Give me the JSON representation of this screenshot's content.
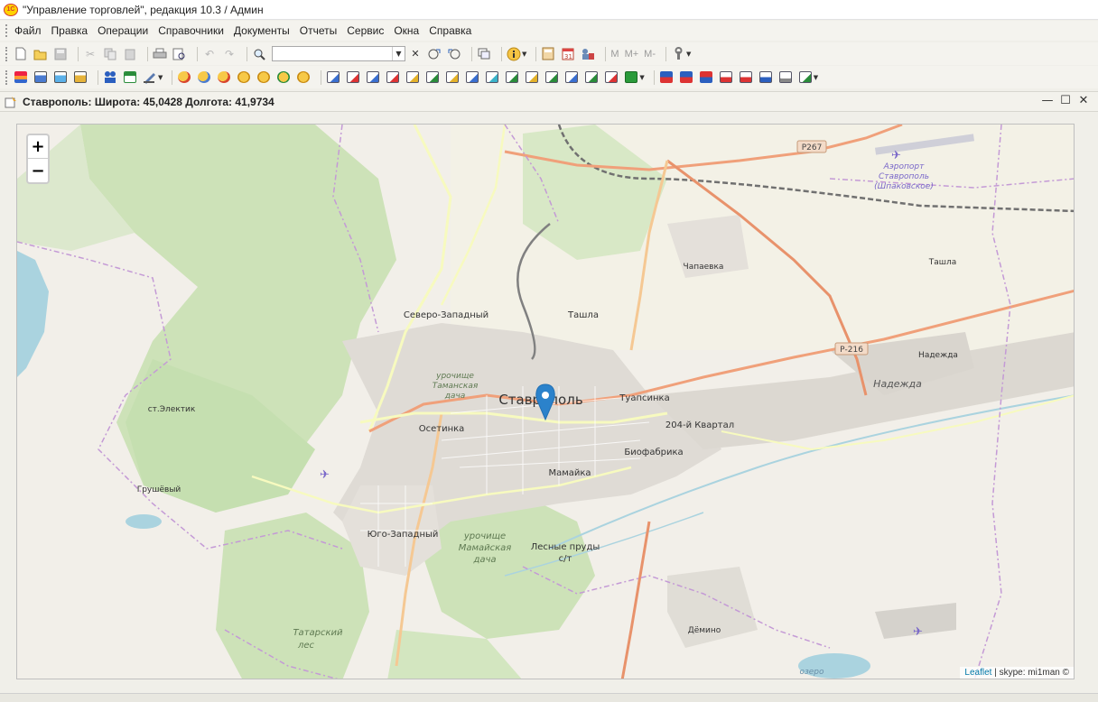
{
  "window": {
    "title": "\"Управление торговлей\", редакция 10.3 / Админ",
    "logo_text": "1С"
  },
  "menu": [
    "Файл",
    "Правка",
    "Операции",
    "Справочники",
    "Документы",
    "Отчеты",
    "Сервис",
    "Окна",
    "Справка"
  ],
  "toolbar": {
    "search_value": "",
    "memory_m": "M",
    "memory_mplus": "M+",
    "memory_mminus": "M-"
  },
  "form": {
    "title": "Ставрополь:  Широта: 45,0428 Долгота: 41,9734"
  },
  "map": {
    "labels": {
      "stavropol": "Ставрополь",
      "severo_zapadny": "Северо-Западный",
      "tashla_city": "Ташла",
      "tashla_village": "Ташла",
      "chapaevka": "Чапаевка",
      "airport_line1": "Аэропорт",
      "airport_line2": "Ставрополь",
      "airport_line3": "(Шпаковское)",
      "nadezhda": "Надежда",
      "nadezhda_area": "Надежда",
      "tuapsinka": "Туапсинка",
      "kvartal204": "204-й Квартал",
      "biofabrika": "Биофабрика",
      "mamayka": "Мамайка",
      "osetinka": "Осетинка",
      "electik": "ст.Электик",
      "grushevy": "Грушёвый",
      "yugo_zapadny": "Юго-Западный",
      "urochishe_taman_1": "урочище",
      "urochishe_taman_2": "Таманская",
      "urochishe_taman_3": "дача",
      "urochishe_mamay_1": "урочище",
      "urochishe_mamay_2": "Мамайская",
      "urochishe_mamay_3": "дача",
      "lesnye_prudy_1": "Лесные пруды",
      "lesnye_prudy_2": "с/т",
      "tatarsky_1": "Татарский",
      "tatarsky_2": "лес",
      "demino": "Дёмино",
      "ozero": "озеро",
      "road_p267": "Р267",
      "road_p216": "Р-216"
    },
    "zoom_in": "+",
    "zoom_out": "−",
    "attribution_link": "Leaflet",
    "attribution_text": "| skype: mi1man ©"
  }
}
